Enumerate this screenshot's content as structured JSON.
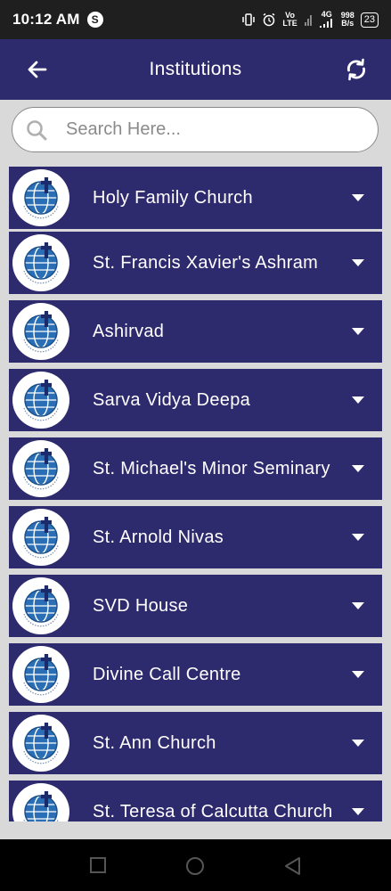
{
  "status_bar": {
    "time": "10:12 AM",
    "app_badge": "S",
    "volte_top": "Vo",
    "volte_bottom": "LTE",
    "network": "4G",
    "speed_value": "998",
    "speed_unit": "B/s",
    "battery": "23"
  },
  "app_bar": {
    "title": "Institutions",
    "background_color": "#2e2a6e"
  },
  "search": {
    "placeholder": "Search Here..."
  },
  "institutions": [
    {
      "name": "Holy Family Church"
    },
    {
      "name": "St. Francis Xavier's Ashram"
    },
    {
      "name": "Ashirvad"
    },
    {
      "name": "Sarva Vidya Deepa"
    },
    {
      "name": "St. Michael's Minor Seminary"
    },
    {
      "name": "St. Arnold Nivas"
    },
    {
      "name": "SVD House"
    },
    {
      "name": "Divine Call Centre"
    },
    {
      "name": "St. Ann Church"
    },
    {
      "name": "St. Teresa of Calcutta Church"
    }
  ],
  "icons": {
    "back": "arrow-left-icon",
    "refresh": "refresh-icon",
    "search": "search-icon",
    "expand": "chevron-down-icon",
    "logo": "divine-word-missionaries-logo"
  }
}
